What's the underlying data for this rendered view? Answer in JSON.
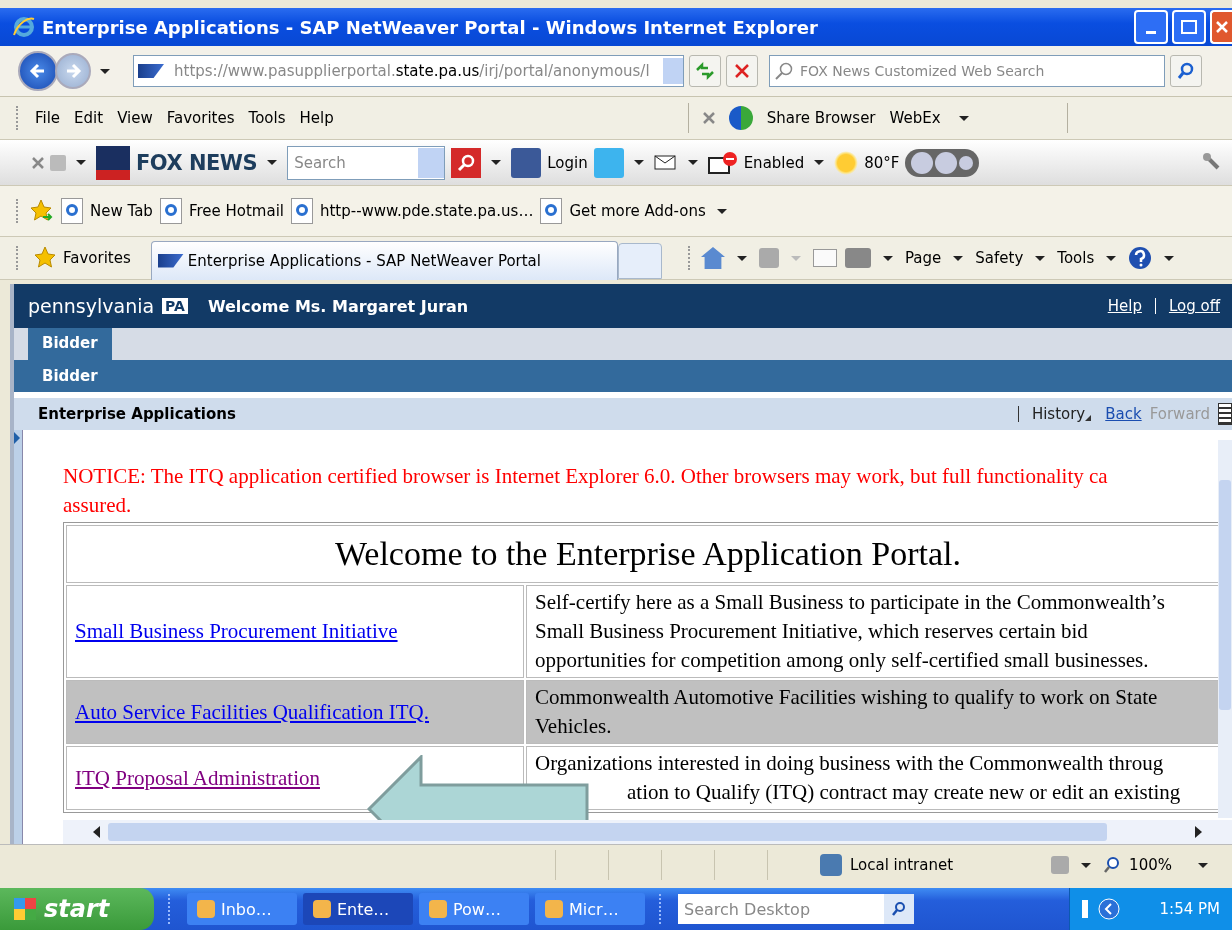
{
  "window": {
    "title": "Enterprise Applications - SAP NetWeaver Portal - Windows Internet Explorer"
  },
  "address_bar": {
    "url_prefix": "https://www.pasupplierportal.",
    "url_host": "state.pa.us",
    "url_suffix": "/irj/portal/anonymous/l"
  },
  "search_box": {
    "placeholder": "FOX News Customized Web Search"
  },
  "menu": [
    "File",
    "Edit",
    "View",
    "Favorites",
    "Tools",
    "Help"
  ],
  "webex_bar": {
    "share": "Share Browser",
    "webex": "WebEx"
  },
  "fox_toolbar": {
    "brand": "FOX NEWS",
    "search_placeholder": "Search",
    "login": "Login",
    "popup": "Enabled",
    "weather": "80°F"
  },
  "links_bar": [
    "New Tab",
    "Free Hotmail",
    "http--www.pde.state.pa.us…"
  ],
  "addons": "Get more Add-ons",
  "favorites": "Favorites",
  "tab": {
    "title": "Enterprise Applications - SAP NetWeaver Portal"
  },
  "command_bar": [
    "Page",
    "Safety",
    "Tools"
  ],
  "portal": {
    "logo": "pennsylvania",
    "logo_badge": "PA",
    "welcome": "Welcome Ms. Margaret Juran",
    "help": "Help",
    "logoff": "Log off",
    "tabs": [
      {
        "label": "Bidder",
        "selected": true
      }
    ],
    "subnav": "Bidder",
    "page_title": "Enterprise Applications",
    "history": "History",
    "nav": [
      {
        "label": "Back",
        "disabled": false
      },
      {
        "label": "Forward",
        "disabled": true
      }
    ]
  },
  "content": {
    "notice_lines": [
      "NOTICE: The ITQ application certified browser is Internet Explorer 6.0. Other browsers may work, but full functionality ca",
      "assured."
    ],
    "heading": "Welcome to the Enterprise Application Portal.",
    "rows": [
      {
        "link": "Small Business Procurement Initiative",
        "visited": false,
        "shaded": false,
        "description": [
          "Self-certify here as a Small Business to participate in the Commonwealth’s",
          "Small Business Procurement Initiative, which reserves certain bid",
          "opportunities for competition among only self-certified small businesses."
        ]
      },
      {
        "link": "Auto Service Facilities Qualification ITQ.",
        "visited": false,
        "shaded": true,
        "description": [
          "Commonwealth Automotive Facilities wishing to qualify to work on State",
          "Vehicles."
        ]
      },
      {
        "link": "ITQ Proposal Administration",
        "visited": true,
        "shaded": false,
        "description": [
          "Organizations interested in doing business with the Commonwealth throug",
          "ation to Qualify (ITQ) contract may create new or edit an existing"
        ]
      }
    ]
  },
  "status_bar": {
    "zone": "Local intranet",
    "zoom": "100%"
  },
  "taskbar": {
    "start": "start",
    "tasks": [
      {
        "label": "Inbo…",
        "selected": false
      },
      {
        "label": "Ente…",
        "selected": true
      },
      {
        "label": "Pow…",
        "selected": false
      },
      {
        "label": "Micr…",
        "selected": false
      }
    ],
    "search_placeholder": "Search Desktop",
    "clock": "1:54 PM"
  }
}
